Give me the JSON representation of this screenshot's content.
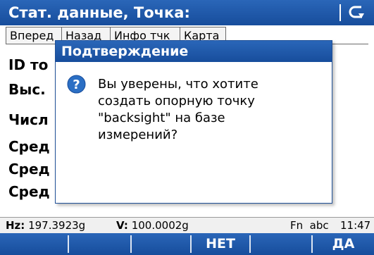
{
  "title_bar": {
    "title": "Стат. данные, Точка:",
    "back_icon": "back-arrow-icon"
  },
  "tabs": [
    {
      "label": "Вперед"
    },
    {
      "label": "Назад"
    },
    {
      "label": "Инфо тчк"
    },
    {
      "label": "Карта"
    }
  ],
  "fields": [
    {
      "label": "ID то"
    },
    {
      "label": "Выс."
    },
    {
      "label": "Числ"
    },
    {
      "label": "Сред"
    },
    {
      "label": "Сред"
    },
    {
      "label": "Сред"
    }
  ],
  "dialog": {
    "title": "Подтверждение",
    "icon": "question-icon",
    "message_lines": [
      "Вы уверены, что хотите",
      "создать опорную точку",
      "\"backsight\" на базе",
      "измерений?"
    ]
  },
  "status_bar": {
    "hz_label": "Hz:",
    "hz_value": "197.3923g",
    "v_label": "V:",
    "v_value": "100.0002g",
    "mode": "Fn  abc",
    "time": "11:47"
  },
  "softkeys": {
    "no_label": "НЕТ",
    "yes_label": "ДА"
  },
  "colors": {
    "accent": "#1f5aa8",
    "dialog_icon": "#2b6fc4"
  }
}
